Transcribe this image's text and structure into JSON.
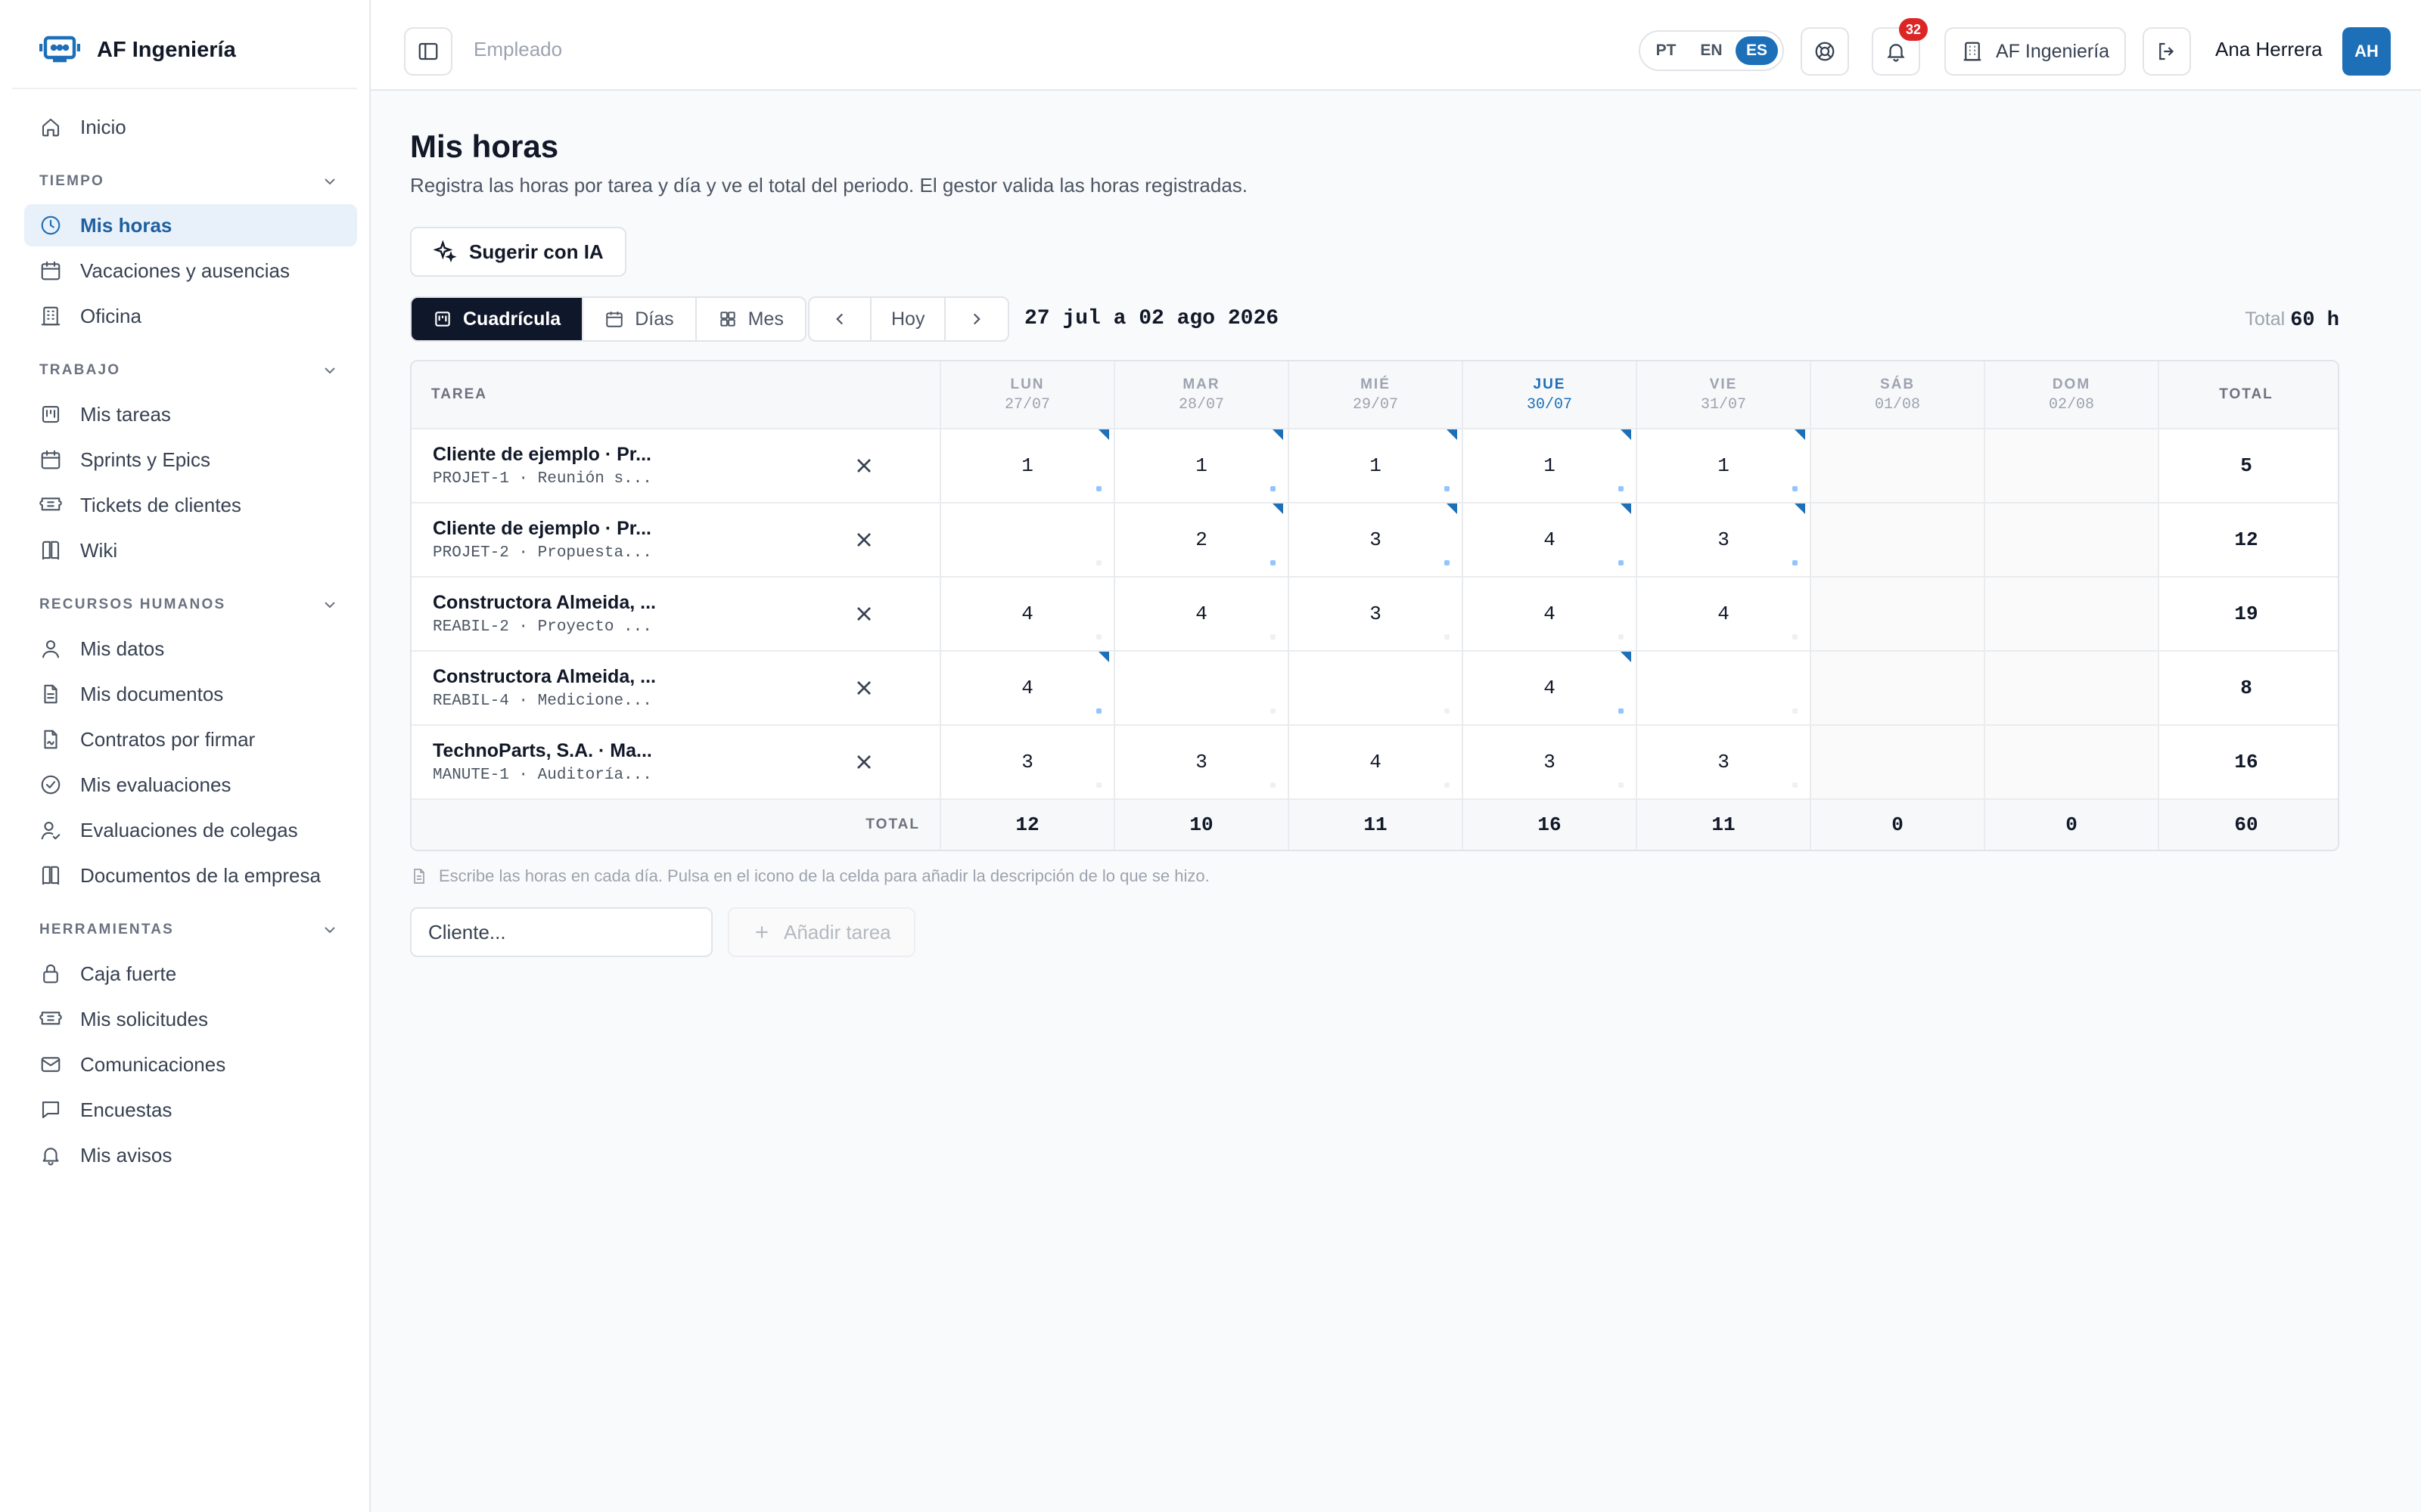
{
  "brand": {
    "name": "AF Ingeniería"
  },
  "sidebar": {
    "top": [
      {
        "label": "Inicio",
        "icon": "home-icon"
      }
    ],
    "sections": [
      {
        "title": "TIEMPO",
        "items": [
          {
            "label": "Mis horas",
            "icon": "clock-icon",
            "active": true
          },
          {
            "label": "Vacaciones y ausencias",
            "icon": "calendar-icon"
          },
          {
            "label": "Oficina",
            "icon": "building-icon"
          }
        ]
      },
      {
        "title": "TRABAJO",
        "items": [
          {
            "label": "Mis tareas",
            "icon": "kanban-icon"
          },
          {
            "label": "Sprints y Epics",
            "icon": "calendar-icon"
          },
          {
            "label": "Tickets de clientes",
            "icon": "ticket-icon"
          },
          {
            "label": "Wiki",
            "icon": "book-icon"
          }
        ]
      },
      {
        "title": "RECURSOS HUMANOS",
        "items": [
          {
            "label": "Mis datos",
            "icon": "user-icon"
          },
          {
            "label": "Mis documentos",
            "icon": "file-icon"
          },
          {
            "label": "Contratos por firmar",
            "icon": "file-sign-icon"
          },
          {
            "label": "Mis evaluaciones",
            "icon": "check-circle-icon"
          },
          {
            "label": "Evaluaciones de colegas",
            "icon": "user-check-icon"
          },
          {
            "label": "Documentos de la empresa",
            "icon": "book-icon"
          }
        ]
      },
      {
        "title": "HERRAMIENTAS",
        "items": [
          {
            "label": "Caja fuerte",
            "icon": "lock-icon"
          },
          {
            "label": "Mis solicitudes",
            "icon": "ticket-icon"
          },
          {
            "label": "Comunicaciones",
            "icon": "mail-icon"
          },
          {
            "label": "Encuestas",
            "icon": "chat-icon"
          },
          {
            "label": "Mis avisos",
            "icon": "bell-icon"
          }
        ]
      }
    ]
  },
  "topbar": {
    "breadcrumb": "Empleado",
    "languages": [
      "PT",
      "EN",
      "ES"
    ],
    "active_language": "ES",
    "notifications_count": "32",
    "company": "AF Ingeniería",
    "user_name": "Ana Herrera",
    "user_initials": "AH"
  },
  "page": {
    "title": "Mis horas",
    "subtitle": "Registra las horas por tarea y día y ve el total del periodo. El gestor valida las horas registradas.",
    "ai_button": "Sugerir con IA",
    "views": [
      "Cuadrícula",
      "Días",
      "Mes"
    ],
    "active_view": "Cuadrícula",
    "today_button": "Hoy",
    "range": "27 jul a 02 ago 2026",
    "total_label": "Total",
    "total_value": "60 h"
  },
  "grid": {
    "task_header": "TAREA",
    "total_header": "TOTAL",
    "footer_label": "TOTAL",
    "days": [
      {
        "name": "LUN",
        "date": "27/07"
      },
      {
        "name": "MAR",
        "date": "28/07"
      },
      {
        "name": "MIÉ",
        "date": "29/07"
      },
      {
        "name": "JUE",
        "date": "30/07",
        "today": true
      },
      {
        "name": "VIE",
        "date": "31/07"
      },
      {
        "name": "SÁB",
        "date": "01/08"
      },
      {
        "name": "DOM",
        "date": "02/08"
      }
    ],
    "rows": [
      {
        "title": "Cliente de ejemplo · Pr...",
        "code": "PROJET-1 · Reunión s...",
        "hours": [
          "1",
          "1",
          "1",
          "1",
          "1",
          "",
          ""
        ],
        "noted": [
          true,
          true,
          true,
          true,
          true,
          false,
          false
        ],
        "total": "5"
      },
      {
        "title": "Cliente de ejemplo · Pr...",
        "code": "PROJET-2 · Propuesta...",
        "hours": [
          "",
          "2",
          "3",
          "4",
          "3",
          "",
          ""
        ],
        "noted": [
          false,
          true,
          true,
          true,
          true,
          false,
          false
        ],
        "total": "12"
      },
      {
        "title": "Constructora Almeida, ...",
        "code": "REABIL-2 · Proyecto ...",
        "hours": [
          "4",
          "4",
          "3",
          "4",
          "4",
          "",
          ""
        ],
        "noted": [
          false,
          false,
          false,
          false,
          false,
          false,
          false
        ],
        "total": "19"
      },
      {
        "title": "Constructora Almeida, ...",
        "code": "REABIL-4 · Medicione...",
        "hours": [
          "4",
          "",
          "",
          "4",
          "",
          "",
          ""
        ],
        "noted": [
          true,
          false,
          false,
          true,
          false,
          false,
          false
        ],
        "total": "8"
      },
      {
        "title": "TechnoParts, S.A. · Ma...",
        "code": "MANUTE-1 · Auditoría...",
        "hours": [
          "3",
          "3",
          "4",
          "3",
          "3",
          "",
          ""
        ],
        "noted": [
          false,
          false,
          false,
          false,
          false,
          false,
          false
        ],
        "total": "16"
      }
    ],
    "day_totals": [
      "12",
      "10",
      "11",
      "16",
      "11",
      "0",
      "0"
    ],
    "grand_total": "60"
  },
  "footer": {
    "hint": "Escribe las horas en cada día. Pulsa en el icono de la celda para añadir la descripción de lo que se hizo.",
    "client_placeholder": "Cliente...",
    "add_task": "Añadir tarea"
  },
  "colors": {
    "accent": "#1d6fb8",
    "dark_button": "#0f172a",
    "badge": "#dc2626"
  }
}
